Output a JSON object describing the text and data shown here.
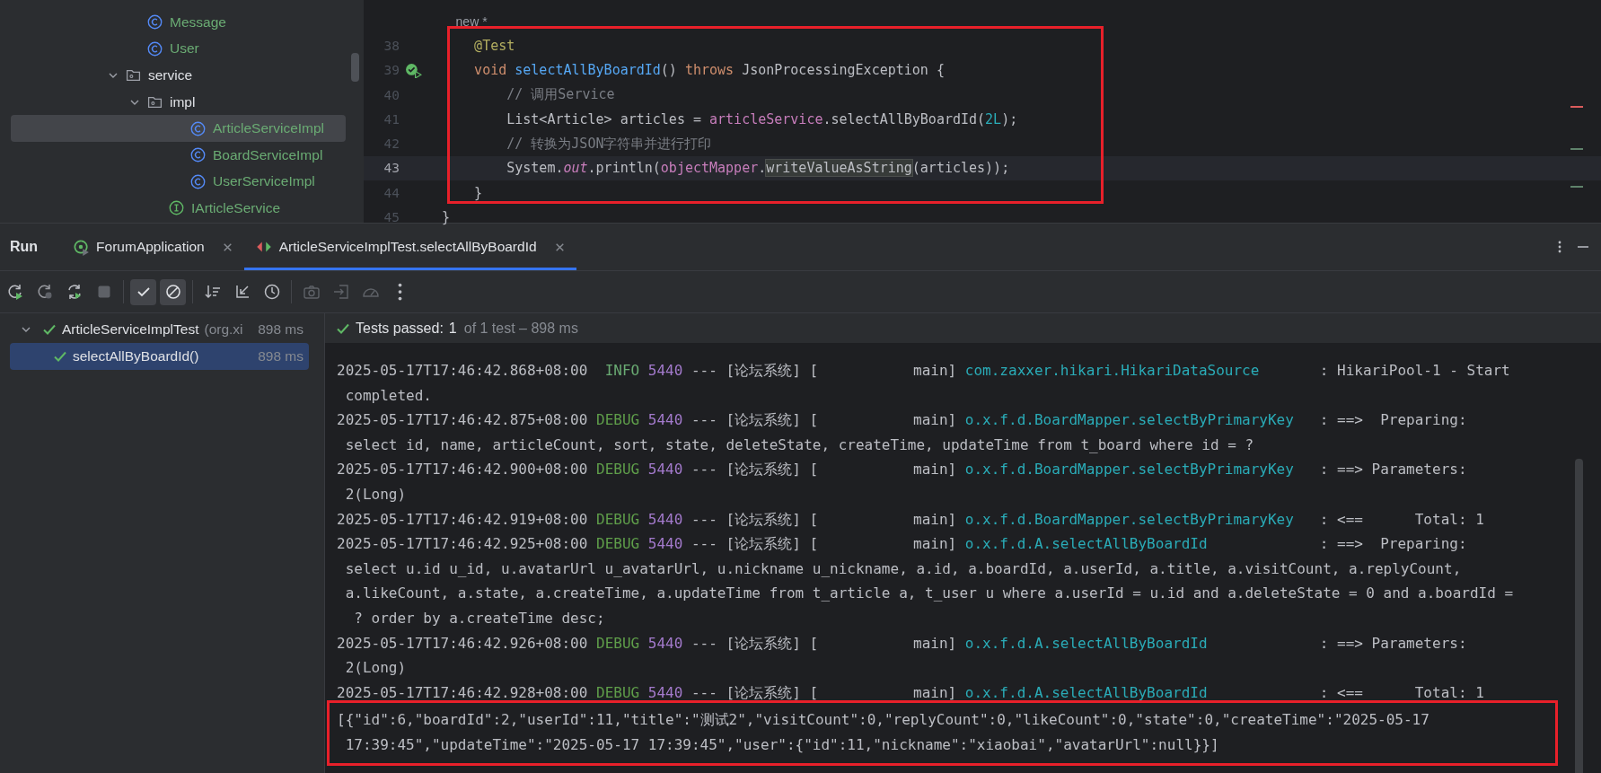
{
  "project_tree": [
    {
      "kind": "class",
      "label": "Message",
      "selected": false
    },
    {
      "kind": "class",
      "label": "User",
      "selected": false
    },
    {
      "kind": "folder",
      "label": "service",
      "expanded": true,
      "selected": false,
      "children": [
        {
          "kind": "folder",
          "label": "impl",
          "expanded": true,
          "selected": false,
          "children": [
            {
              "kind": "class",
              "label": "ArticleServiceImpl",
              "selected": true
            },
            {
              "kind": "class",
              "label": "BoardServiceImpl",
              "selected": false
            },
            {
              "kind": "class",
              "label": "UserServiceImpl",
              "selected": false
            }
          ]
        },
        {
          "kind": "interface",
          "label": "IArticleService",
          "selected": false
        }
      ]
    }
  ],
  "editor": {
    "lines": [
      {
        "current": false,
        "run_marker": false,
        "tokens": [
          {
            "t": "    new *",
            "kind": "hint"
          }
        ]
      },
      {
        "number": "38",
        "current": false,
        "run_marker": false,
        "tokens": [
          {
            "t": "    @Test",
            "kind": "ann"
          }
        ]
      },
      {
        "number": "39",
        "current": false,
        "run_marker": true,
        "tokens": [
          {
            "t": "    void ",
            "kind": "kw"
          },
          {
            "t": "selectAllByBoardId",
            "kind": "fn"
          },
          {
            "t": "() ",
            "kind": "plain"
          },
          {
            "t": "throws ",
            "kind": "kw"
          },
          {
            "t": "JsonProcessingException {",
            "kind": "plain"
          }
        ]
      },
      {
        "number": "40",
        "current": false,
        "run_marker": false,
        "tokens": [
          {
            "t": "        // 调用Service",
            "kind": "cm"
          }
        ]
      },
      {
        "number": "41",
        "current": false,
        "run_marker": false,
        "tokens": [
          {
            "t": "        List<Article> articles = ",
            "kind": "plain"
          },
          {
            "t": "articleService",
            "kind": "field"
          },
          {
            "t": ".selectAllByBoardId(",
            "kind": "plain"
          },
          {
            "t": "2L",
            "kind": "num"
          },
          {
            "t": ");",
            "kind": "plain"
          }
        ]
      },
      {
        "number": "42",
        "current": false,
        "run_marker": false,
        "tokens": [
          {
            "t": "        // 转换为JSON字符串并进行打印",
            "kind": "cm"
          }
        ]
      },
      {
        "number": "43",
        "current": true,
        "run_marker": false,
        "tokens": [
          {
            "t": "        System.",
            "kind": "plain"
          },
          {
            "t": "out",
            "kind": "static"
          },
          {
            "t": ".println(",
            "kind": "plain"
          },
          {
            "t": "objectMapper",
            "kind": "field"
          },
          {
            "t": ".",
            "kind": "plain"
          },
          {
            "t": "writeValueAsString",
            "kind": "match"
          },
          {
            "t": "(articles));",
            "kind": "plain"
          }
        ]
      },
      {
        "number": "44",
        "current": false,
        "run_marker": false,
        "tokens": [
          {
            "t": "    }",
            "kind": "plain"
          }
        ]
      },
      {
        "number": "45",
        "current": false,
        "run_marker": false,
        "tokens": [
          {
            "t": "}",
            "kind": "plain"
          }
        ]
      }
    ]
  },
  "run_panel": {
    "title": "Run",
    "tabs": [
      {
        "label": "ForumApplication",
        "kind": "app",
        "selected": false
      },
      {
        "label": "ArticleServiceImplTest.selectAllByBoardId",
        "kind": "test",
        "selected": true
      }
    ],
    "toolbar_groups": [
      {
        "buttons": [
          {
            "kind": "rerun",
            "on": false,
            "disabled": false
          },
          {
            "kind": "rerun-failed",
            "on": false,
            "disabled": true
          },
          {
            "kind": "toggle-auto",
            "on": false,
            "disabled": false
          },
          {
            "kind": "stop",
            "on": false,
            "disabled": true
          }
        ]
      },
      {
        "buttons": [
          {
            "kind": "show-passed",
            "on": true,
            "disabled": false
          },
          {
            "kind": "show-ignored",
            "on": true,
            "disabled": false
          }
        ]
      },
      {
        "buttons": [
          {
            "kind": "sort",
            "on": false,
            "disabled": false
          },
          {
            "kind": "import",
            "on": false,
            "disabled": false
          },
          {
            "kind": "history",
            "on": false,
            "disabled": false
          }
        ]
      },
      {
        "buttons": [
          {
            "kind": "screenshot",
            "on": false,
            "disabled": true
          },
          {
            "kind": "export",
            "on": false,
            "disabled": true
          },
          {
            "kind": "coverage",
            "on": false,
            "disabled": true
          },
          {
            "kind": "more",
            "on": false,
            "disabled": false
          }
        ]
      }
    ],
    "tests": [
      {
        "label": "ArticleServiceImplTest",
        "detail": "(org.xi",
        "time": "898 ms",
        "passed": true,
        "expanded": true,
        "selected": false,
        "children": [
          {
            "label": "selectAllByBoardId()",
            "time": "898 ms",
            "passed": true,
            "selected": true
          }
        ]
      }
    ],
    "status": {
      "text": "Tests passed:",
      "count": "1",
      "detail": "of 1 test – 898 ms"
    },
    "console": [
      {
        "kind": "log",
        "time": "2025-05-17T17:46:42.868+08:00",
        "level": "INFO",
        "pid": "5440",
        "sep": "---",
        "app": "[论坛系统]",
        "thread": "[           main]",
        "logger": "com.zaxxer.hikari.HikariDataSource",
        "message": ": HikariPool-1 - Start"
      },
      {
        "kind": "cont",
        "text": "completed."
      },
      {
        "kind": "log",
        "time": "2025-05-17T17:46:42.875+08:00",
        "level": "DEBUG",
        "pid": "5440",
        "sep": "---",
        "app": "[论坛系统]",
        "thread": "[           main]",
        "logger": "o.x.f.d.BoardMapper.selectByPrimaryKey",
        "message": ": ==>  Preparing:"
      },
      {
        "kind": "cont",
        "text": "select id, name, articleCount, sort, state, deleteState, createTime, updateTime from t_board where id = ?"
      },
      {
        "kind": "log",
        "time": "2025-05-17T17:46:42.900+08:00",
        "level": "DEBUG",
        "pid": "5440",
        "sep": "---",
        "app": "[论坛系统]",
        "thread": "[           main]",
        "logger": "o.x.f.d.BoardMapper.selectByPrimaryKey",
        "message": ": ==> Parameters:"
      },
      {
        "kind": "cont",
        "text": "2(Long)"
      },
      {
        "kind": "log",
        "time": "2025-05-17T17:46:42.919+08:00",
        "level": "DEBUG",
        "pid": "5440",
        "sep": "---",
        "app": "[论坛系统]",
        "thread": "[           main]",
        "logger": "o.x.f.d.BoardMapper.selectByPrimaryKey",
        "message": ": <==      Total: 1"
      },
      {
        "kind": "log",
        "time": "2025-05-17T17:46:42.925+08:00",
        "level": "DEBUG",
        "pid": "5440",
        "sep": "---",
        "app": "[论坛系统]",
        "thread": "[           main]",
        "logger": "o.x.f.d.A.selectAllByBoardId",
        "message": ": ==>  Preparing:"
      },
      {
        "kind": "cont",
        "text": "select u.id u_id, u.avatarUrl u_avatarUrl, u.nickname u_nickname, a.id, a.boardId, a.userId, a.title, a.visitCount, a.replyCount,"
      },
      {
        "kind": "cont",
        "text": "a.likeCount, a.state, a.createTime, a.updateTime from t_article a, t_user u where a.userId = u.id and a.deleteState = 0 and a.boardId ="
      },
      {
        "kind": "cont",
        "text": " ? order by a.createTime desc;"
      },
      {
        "kind": "log",
        "time": "2025-05-17T17:46:42.926+08:00",
        "level": "DEBUG",
        "pid": "5440",
        "sep": "---",
        "app": "[论坛系统]",
        "thread": "[           main]",
        "logger": "o.x.f.d.A.selectAllByBoardId",
        "message": ": ==> Parameters:"
      },
      {
        "kind": "cont",
        "text": "2(Long)"
      },
      {
        "kind": "log",
        "time": "2025-05-17T17:46:42.928+08:00",
        "level": "DEBUG",
        "pid": "5440",
        "sep": "---",
        "app": "[论坛系统]",
        "thread": "[           main]",
        "logger": "o.x.f.d.A.selectAllByBoardId",
        "message": ": <==      Total: 1"
      }
    ],
    "output": [
      "[{\"id\":6,\"boardId\":2,\"userId\":11,\"title\":\"测试2\",\"visitCount\":0,\"replyCount\":0,\"likeCount\":0,\"state\":0,\"createTime\":\"2025-05-17",
      "17:39:45\",\"updateTime\":\"2025-05-17 17:39:45\",\"user\":{\"id\":11,\"nickname\":\"xiaobai\",\"avatarUrl\":null}}]"
    ]
  }
}
